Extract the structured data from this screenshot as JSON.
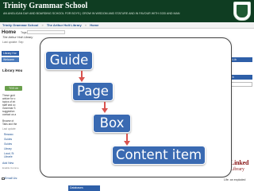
{
  "header": {
    "school_name": "Trinity Grammar School",
    "motto": "AN ANGLICAN DAY AND BOARDING SCHOOL FOR BOYS | GROW IN WISDOM AND STATURE AND IN FAVOUR WITH GOD AND MAN"
  },
  "nav": {
    "items": [
      "Trinity Grammar School",
      "»",
      "The Arthur Holt Library",
      "»",
      "Home"
    ]
  },
  "page": {
    "title": "Home",
    "tags_label": "Tags:",
    "description": "The Arthur Holt Library",
    "last_update": "Last update: Sep"
  },
  "left": {
    "tab1": "Library Hor",
    "tab2": "Welcome",
    "heading": "Library Hou",
    "button": "TGS Lib",
    "paragraphs": [
      "These guid",
      "advice for c",
      "topics of int",
      "staff and co",
      "Grammar S",
      "suggestion",
      "contact us a"
    ],
    "browse": "Browse ot",
    "browse2": "Tabs and the",
    "last_update_link": "Last update",
    "list": [
      "Researc",
      "Guides",
      "Guides",
      "Library",
      "Local, St",
      "Librarie"
    ],
    "add_news": "Add New",
    "enable": "Enable Comme",
    "email": "Email Us:"
  },
  "right": {
    "box1": "Ask a Lib",
    "box2": "Search",
    "logo_top": "Linked",
    "logo_bottom": "Library",
    "life_text": "Life: an exploded",
    "bottom_tab": "Databases"
  },
  "overlay": {
    "items": [
      "Guide",
      "Page",
      "Box",
      "Content item"
    ]
  },
  "colors": {
    "header_bg": "#0f3d22",
    "accent_blue": "#3a6ab2",
    "arrow_red": "#d9534f"
  }
}
